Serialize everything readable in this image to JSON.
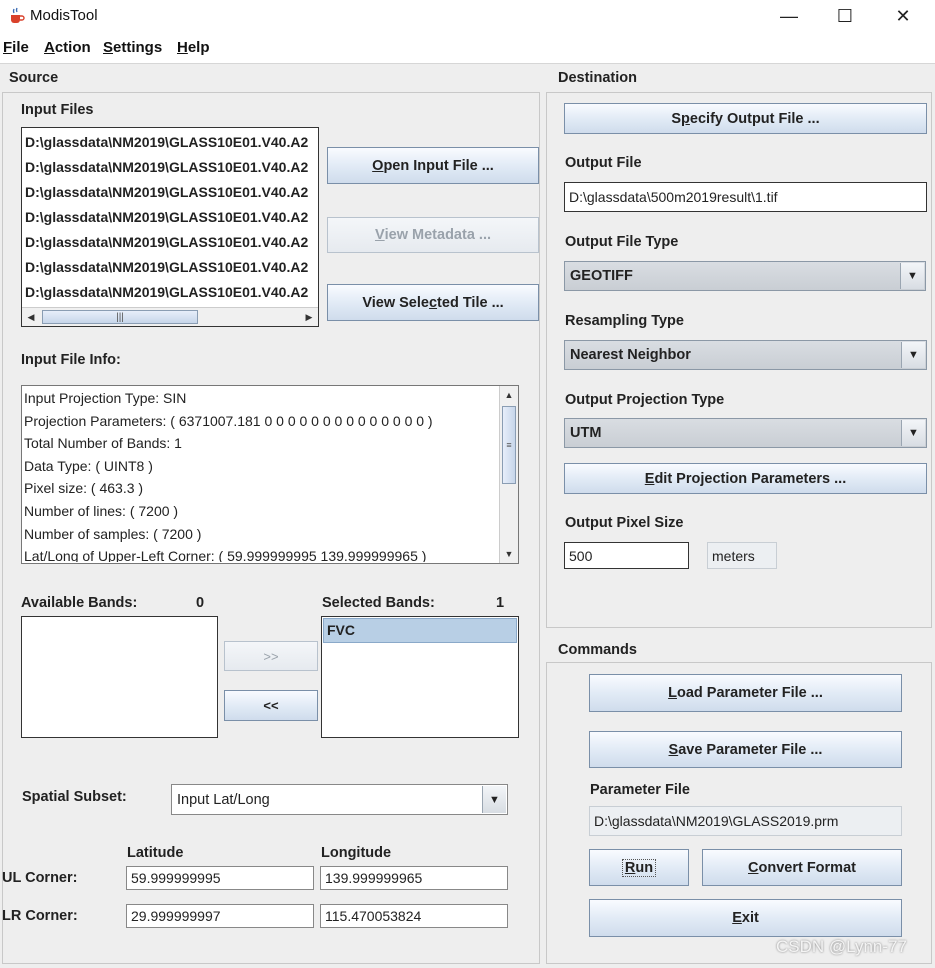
{
  "window": {
    "title": "ModisTool",
    "icon": "java-cup-icon",
    "controls": {
      "minimize": "—",
      "maximize": "☐",
      "close": "✕"
    }
  },
  "menu": {
    "items": [
      {
        "label": "File",
        "mnemonic": "F",
        "rest": "ile"
      },
      {
        "label": "Action",
        "mnemonic": "A",
        "rest": "ction"
      },
      {
        "label": "Settings",
        "mnemonic": "S",
        "rest": "ettings"
      },
      {
        "label": "Help",
        "mnemonic": "H",
        "rest": "elp"
      }
    ]
  },
  "source": {
    "title": "Source",
    "input_files_label": "Input Files",
    "input_files": [
      "D:\\glassdata\\NM2019\\GLASS10E01.V40.A2",
      "D:\\glassdata\\NM2019\\GLASS10E01.V40.A2",
      "D:\\glassdata\\NM2019\\GLASS10E01.V40.A2",
      "D:\\glassdata\\NM2019\\GLASS10E01.V40.A2",
      "D:\\glassdata\\NM2019\\GLASS10E01.V40.A2",
      "D:\\glassdata\\NM2019\\GLASS10E01.V40.A2",
      "D:\\glassdata\\NM2019\\GLASS10E01.V40.A2"
    ],
    "buttons": {
      "open_input_file": {
        "pre": "",
        "u": "O",
        "post": "pen Input File ..."
      },
      "view_metadata": {
        "pre": "",
        "u": "V",
        "post": "iew Metadata ..."
      },
      "view_selected_tile": {
        "pre": "View Sele",
        "u": "c",
        "post": "ted Tile  ..."
      }
    },
    "input_file_info_label": "Input File Info:",
    "input_file_info": [
      "Input Projection Type: SIN",
      "Projection Parameters: ( 6371007.181 0 0 0 0 0 0 0 0 0 0 0 0 0 0 )",
      "Total Number of Bands: 1",
      "Data Type: ( UINT8 )",
      "Pixel size: ( 463.3 )",
      "Number of lines: ( 7200 )",
      "Number of samples: ( 7200 )",
      "Lat/Long of Upper-Left Corner: ( 59.999999995 139.999999965 )"
    ],
    "available_bands_label": "Available Bands:",
    "available_bands_count": "0",
    "available_bands": [],
    "selected_bands_label": "Selected Bands:",
    "selected_bands_count": "1",
    "selected_bands": [
      "FVC"
    ],
    "add_band_label": ">>",
    "remove_band_label": "<<",
    "spatial_subset_label": "Spatial Subset:",
    "spatial_subset_value": "Input Lat/Long",
    "latitude_label": "Latitude",
    "longitude_label": "Longitude",
    "ul_corner_label": "UL Corner:",
    "lr_corner_label": "LR Corner:",
    "ul_latitude": "59.999999995",
    "ul_longitude": "139.999999965",
    "lr_latitude": "29.999999997",
    "lr_longitude": "115.470053824"
  },
  "destination": {
    "title": "Destination",
    "buttons": {
      "specify_output_file": {
        "pre": "S",
        "u": "p",
        "post": "ecify Output File ..."
      },
      "edit_projection_parameters": {
        "pre": "",
        "u": "E",
        "post": "dit Projection Parameters ..."
      }
    },
    "output_file_label": "Output File",
    "output_file_value": "D:\\glassdata\\500m2019result\\1.tif",
    "output_file_type_label": "Output File Type",
    "output_file_type_value": "GEOTIFF",
    "resampling_type_label": "Resampling Type",
    "resampling_type_value": "Nearest Neighbor",
    "output_projection_type_label": "Output Projection Type",
    "output_projection_type_value": "UTM",
    "output_pixel_size_label": "Output Pixel Size",
    "output_pixel_size_value": "500",
    "output_pixel_unit": "meters"
  },
  "commands": {
    "title": "Commands",
    "buttons": {
      "load_parameter_file": {
        "pre": "",
        "u": "L",
        "post": "oad Parameter File ..."
      },
      "save_parameter_file": {
        "pre": "",
        "u": "S",
        "post": "ave Parameter File ..."
      },
      "run": {
        "pre": "",
        "u": "R",
        "post": "un"
      },
      "convert_format": {
        "pre": "",
        "u": "C",
        "post": "onvert Format"
      },
      "exit": {
        "pre": "",
        "u": "E",
        "post": "xit"
      }
    },
    "parameter_file_label": "Parameter File",
    "parameter_file_value": "D:\\glassdata\\NM2019\\GLASS2019.prm"
  },
  "watermark": "CSDN @Lynn-77",
  "colors": {
    "selection": "#b8cfe5",
    "button_border": "#7a8fa8",
    "window_bg": "#eeeeee"
  }
}
